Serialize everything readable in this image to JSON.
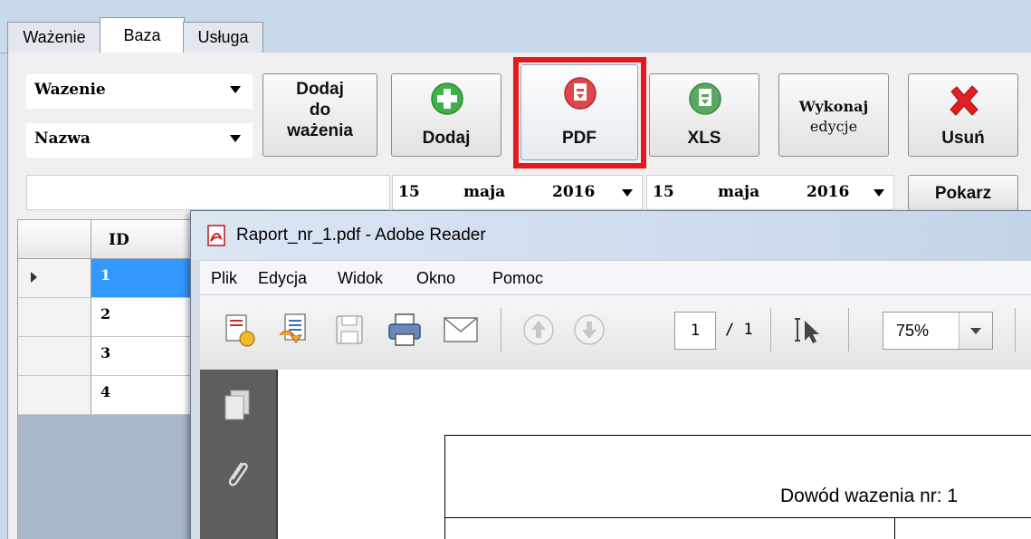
{
  "tabs": [
    {
      "label": "Ważenie"
    },
    {
      "label": "Baza"
    },
    {
      "label": "Usługa"
    }
  ],
  "combos": {
    "first": "Wazenie",
    "second": "Nazwa"
  },
  "buttons": {
    "add_to_weighing": [
      "Dodaj",
      "do",
      "ważenia"
    ],
    "add": "Dodaj",
    "pdf": "PDF",
    "xls": "XLS",
    "edit": [
      "Wykonaj",
      "edycje"
    ],
    "delete": "Usuń",
    "show": "Pokarz"
  },
  "search": {
    "value": ""
  },
  "date_from": {
    "day": "15",
    "month": "maja",
    "year": "2016"
  },
  "date_to": {
    "day": "15",
    "month": "maja",
    "year": "2016"
  },
  "grid": {
    "header": "ID",
    "rows": [
      "1",
      "2",
      "3",
      "4"
    ],
    "selected_row": "1"
  },
  "reader": {
    "title": "Raport_nr_1.pdf - Adobe Reader",
    "menu": [
      "Plik",
      "Edycja",
      "Widok",
      "Okno",
      "Pomoc"
    ],
    "page_current": "1",
    "page_total": "/ 1",
    "zoom": "75%",
    "doc_heading": "Dowód wazenia nr: 1"
  },
  "colors": {
    "highlight": "#e5181e",
    "selection": "#3399ff",
    "app_bg": "#c9d9ec"
  }
}
